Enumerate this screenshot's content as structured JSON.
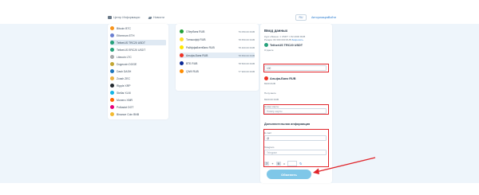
{
  "topbar": {
    "link_1": "Центр Информации",
    "link_2": "Новости",
    "lang": "RU",
    "login": "Авторизация",
    "register": "Войти"
  },
  "left_list": [
    {
      "label": "Bitcoin BTC",
      "color": "#f7931a",
      "selected": false
    },
    {
      "label": "Ethereum ETH",
      "color": "#6b7fd1",
      "selected": false
    },
    {
      "label": "TetherUS TRC20 USDT",
      "color": "#26a17b",
      "selected": true
    },
    {
      "label": "TetherUS ERC20 USDT",
      "color": "#26a17b",
      "selected": false
    },
    {
      "label": "Litecoin LTC",
      "color": "#a6a9aa",
      "selected": false
    },
    {
      "label": "Dogecoin DOGE",
      "color": "#c2a633",
      "selected": false
    },
    {
      "label": "Dash DASH",
      "color": "#1c75bc",
      "selected": false
    },
    {
      "label": "Zcash ZEC",
      "color": "#ecb244",
      "selected": false
    },
    {
      "label": "Ripple XRP",
      "color": "#23292f",
      "selected": false
    },
    {
      "label": "Stellar XLM",
      "color": "#14b6e7",
      "selected": false
    },
    {
      "label": "Monero XMR",
      "color": "#ff6600",
      "selected": false
    },
    {
      "label": "Polkadot DOT",
      "color": "#e6007a",
      "selected": false
    },
    {
      "label": "Binance Coin BNB",
      "color": "#f3ba2f",
      "selected": false
    }
  ],
  "mid_list": [
    {
      "label": "Сбербанк RUB",
      "rate": "79 050.00 RUB",
      "color": "#21a038",
      "selected": false
    },
    {
      "label": "Тинькофф RUB",
      "rate": "78 650.00 RUB",
      "color": "#ffdd2d",
      "selected": false
    },
    {
      "label": "Райффайзенбанк RUB",
      "rate": "78 400.00 RUB",
      "color": "#fee600",
      "selected": false
    },
    {
      "label": "Альфа-Банк RUB",
      "rate": "78 650.00 RUB",
      "color": "#ef3124",
      "selected": true
    },
    {
      "label": "ВТБ RUB",
      "rate": "78 500.00 RUB",
      "color": "#0a2896",
      "selected": false
    },
    {
      "label": "QIWI RUB",
      "rate": "77 900.00 RUB",
      "color": "#ff8c00",
      "selected": false
    }
  ],
  "form": {
    "title": "Ввод данных",
    "rate_line": "Курс обмена: 1 USDT = 82.2000 RUB",
    "reserve_line": "Резерв: 82 000 000 RUB",
    "reserve_link": "Запросить",
    "give_name": "TetherUS TRC20 USDT",
    "give_label": "Отдаете",
    "give_value": "100",
    "get_name": "Альфа-Банк RUB",
    "get_amount": "8220 RUB",
    "get_label": "Получаете",
    "get_value": "8220.00 RUB",
    "card_label": "Номер карты",
    "card_placeholder": "Номер карты",
    "extra_title": "Дополнительная информация",
    "email_label": "E-mail",
    "email_value": "@",
    "telegram_label": "Telegram",
    "telegram_placeholder": "Telegram",
    "captcha_a": "7",
    "captcha_b": "9",
    "captcha_eq": "=",
    "submit": "Обменять"
  },
  "colors": {
    "accent": "#2f7fd1",
    "highlight_box": "#e0242a",
    "submit_bg": "#7fc7e8"
  }
}
